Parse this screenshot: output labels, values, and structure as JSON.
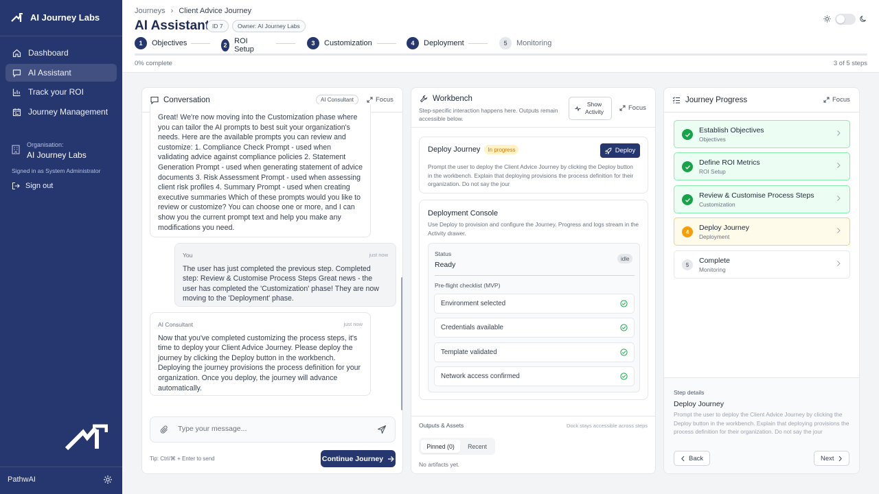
{
  "brand": {
    "name": "AI Journey Labs"
  },
  "sidebar": {
    "items": [
      {
        "label": "Dashboard",
        "icon": "home-icon"
      },
      {
        "label": "AI Assistant",
        "icon": "chat-icon",
        "active": true
      },
      {
        "label": "Track your ROI",
        "icon": "bar-chart-icon"
      },
      {
        "label": "Journey Management",
        "icon": "calendar-icon"
      }
    ],
    "org_label": "Organisation:",
    "org_name": "AI Journey Labs",
    "signed_in": "Signed in as System Administrator",
    "sign_out": "Sign out",
    "footer": "PathwAI"
  },
  "header": {
    "breadcrumb": [
      "Journeys",
      "Client Advice Journey"
    ],
    "title": "AI Assistant",
    "id_pill": "ID 7",
    "owner_pill": "Owner: AI Journey Labs",
    "steps": [
      {
        "num": "1",
        "label": "Objectives"
      },
      {
        "num": "2",
        "label": "ROI Setup"
      },
      {
        "num": "3",
        "label": "Customization"
      },
      {
        "num": "4",
        "label": "Deployment"
      },
      {
        "num": "5",
        "label": "Monitoring"
      }
    ],
    "progress_left": "0% complete",
    "progress_right": "3 of 5 steps",
    "progress_percent": 0
  },
  "conversation": {
    "title": "Conversation",
    "tag": "AI Consultant",
    "focus": "Focus",
    "messages": [
      {
        "text": "Great! We're now moving into the Customization phase where you can tailor the AI prompts to best suit your organization's needs. Here are the available prompts you can review and customize: 1. Compliance Check Prompt - used when validating advice against compliance policies 2. Statement Generation Prompt - used when generating statement of advice documents 3. Risk Assessment Prompt - used when assessing client risk profiles 4. Summary Prompt - used when creating executive summaries Which of these prompts would you like to review or customize? You can choose one or more, and I can show you the current prompt text and help you make any modifications you need."
      },
      {
        "sender": "You",
        "time": "just now",
        "text": "The user has just completed the previous step. Completed step: Review & Customise Process Steps Great news - the user has completed the 'Customization' phase! They are now moving to the 'Deployment' phase."
      },
      {
        "sender": "AI Consultant",
        "time": "just now",
        "text": "Now that you've completed customizing the process steps, it's time to deploy your Client Advice Journey. Please deploy the journey by clicking the Deploy button in the workbench. Deploying the journey provisions the process definition for your organization. Once you deploy, the journey will advance automatically."
      }
    ],
    "input_placeholder": "Type your message...",
    "tip": "Tip: Ctrl/⌘ + Enter to send",
    "continue_label": "Continue Journey"
  },
  "workbench": {
    "title": "Workbench",
    "desc": "Step-specific interaction happens here. Outputs remain accessible below.",
    "show_activity": "Show Activity",
    "focus": "Focus",
    "deploy": {
      "title": "Deploy Journey",
      "status": "In progress",
      "button": "Deploy",
      "desc": "Prompt the user to deploy the Client Advice Journey by clicking the Deploy button in the workbench. Explain that deploying provisions the process definition for their organization. Do not say the jour"
    },
    "console": {
      "title": "Deployment Console",
      "desc": "Use Deploy to provision and configure the Journey. Progress and logs stream in the Activity drawer.",
      "status_label": "Status",
      "status_value": "Ready",
      "badge": "idle",
      "checklist_label": "Pre-flight checklist (MVP)",
      "checklist": [
        "Environment selected",
        "Credentials available",
        "Template validated",
        "Network access confirmed"
      ]
    },
    "outputs_label": "Outputs & Assets",
    "outputs_dock": "Dock stays accessible across steps",
    "tabs": [
      "Pinned (0)",
      "Recent"
    ],
    "no_artifacts": "No artifacts yet."
  },
  "journey": {
    "title": "Journey Progress",
    "focus": "Focus",
    "items": [
      {
        "title": "Establish Objectives",
        "sub": "Objectives",
        "state": "done"
      },
      {
        "title": "Define ROI Metrics",
        "sub": "ROI Setup",
        "state": "done"
      },
      {
        "title": "Review & Customise Process Steps",
        "sub": "Customization",
        "state": "done"
      },
      {
        "title": "Deploy Journey",
        "sub": "Deployment",
        "state": "current",
        "num": "4"
      },
      {
        "title": "Complete",
        "sub": "Monitoring",
        "state": "pending",
        "num": "5"
      }
    ],
    "details_label": "Step details",
    "details_title": "Deploy Journey",
    "details_desc": "Prompt the user to deploy the Client Advice Journey by clicking the Deploy button in the workbench. Explain that deploying provisions the process definition for their organization. Do not say the jour",
    "back": "Back",
    "next": "Next"
  }
}
